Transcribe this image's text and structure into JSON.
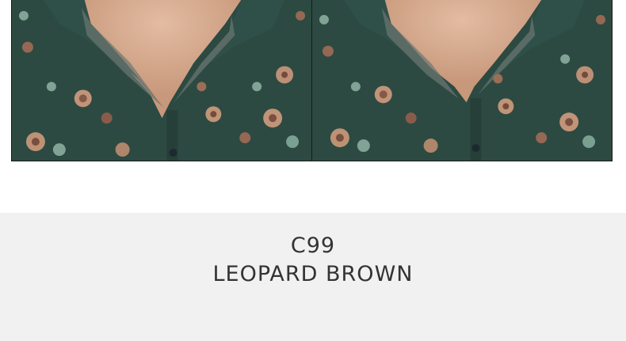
{
  "product": {
    "code": "C99",
    "color_name": "LEOPARD BROWN"
  },
  "photos": [
    {
      "subject": "floral-shirt-collar-closeup"
    },
    {
      "subject": "floral-shirt-collar-closeup"
    }
  ],
  "colors": {
    "caption_background": "#f1f1f1",
    "caption_text": "#333333",
    "shirt_base": "#2c4a42",
    "skin": "#d7ae93"
  }
}
